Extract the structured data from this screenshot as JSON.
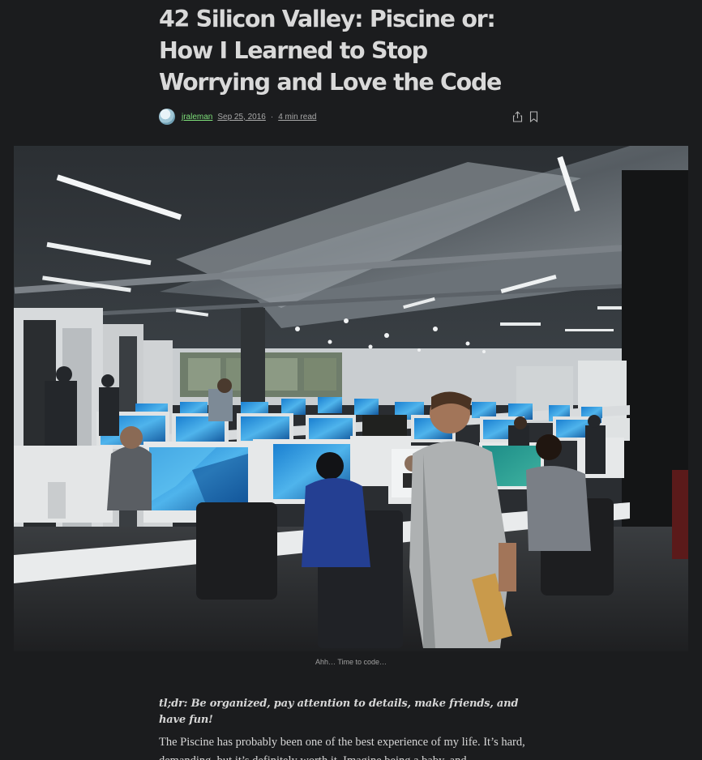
{
  "article": {
    "title": "42 Silicon Valley: Piscine or: How I Learned to Stop Worrying and Love the Code",
    "author": "jraleman",
    "date": "Sep 25, 2016",
    "separator": "·",
    "read_time": "4 min read",
    "caption": "Ahh… Time to code…",
    "tldr": "tl;dr: Be organized, pay attention to details, make friends, and have fun!",
    "paragraph_1": "The Piscine has probably been one of the best experience of my life. It’s hard, demanding, but it’s definitely worth it. Imagine being a baby, and"
  },
  "icons": {
    "share": "share-icon",
    "bookmark": "bookmark-icon"
  },
  "colors": {
    "background": "#1b1c1e",
    "author_link": "#7ee07a",
    "text": "#d9d9d9"
  }
}
